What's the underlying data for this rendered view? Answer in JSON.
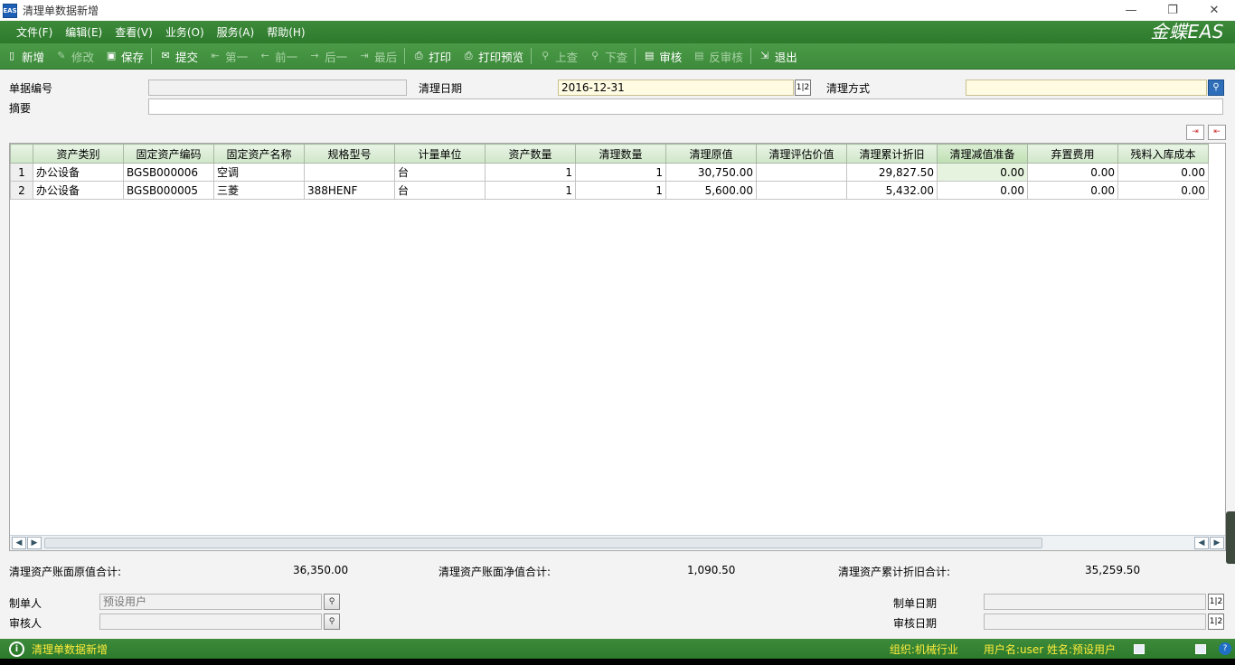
{
  "window": {
    "app_icon": "EAS",
    "title": "清理单数据新增",
    "minimize": "—",
    "restore": "❐",
    "close": "✕"
  },
  "menu": {
    "items": [
      "文件(F)",
      "编辑(E)",
      "查看(V)",
      "业务(O)",
      "服务(A)",
      "帮助(H)"
    ],
    "brand": "金蝶EAS"
  },
  "toolbar": {
    "new": "新增",
    "modify": "修改",
    "save": "保存",
    "submit": "提交",
    "first": "第一",
    "prev": "前一",
    "next": "后一",
    "last": "最后",
    "print": "打印",
    "print_preview": "打印预览",
    "up_query": "上查",
    "down_query": "下查",
    "audit": "审核",
    "unaudit": "反审核",
    "exit": "退出"
  },
  "form": {
    "bill_no_label": "单据编号",
    "bill_no_value": "",
    "clear_date_label": "清理日期",
    "clear_date_value": "2016-12-31",
    "clear_method_label": "清理方式",
    "clear_method_value": "",
    "summary_label": "摘要",
    "summary_value": ""
  },
  "grid": {
    "columns": [
      "",
      "资产类别",
      "固定资产编码",
      "固定资产名称",
      "规格型号",
      "计量单位",
      "资产数量",
      "清理数量",
      "清理原值",
      "清理评估价值",
      "清理累计折旧",
      "清理减值准备",
      "弃置费用",
      "残料入库成本"
    ],
    "rows": [
      [
        "1",
        "办公设备",
        "BGSB000006",
        "空调",
        "",
        "台",
        "1",
        "1",
        "30,750.00",
        "",
        "29,827.50",
        "0.00",
        "0.00",
        "0.00"
      ],
      [
        "2",
        "办公设备",
        "BGSB000005",
        "三菱",
        "388HENF",
        "台",
        "1",
        "1",
        "5,600.00",
        "",
        "5,432.00",
        "0.00",
        "0.00",
        "0.00"
      ]
    ]
  },
  "totals": {
    "original_label": "清理资产账面原值合计:",
    "original_value": "36,350.00",
    "net_label": "清理资产账面净值合计:",
    "net_value": "1,090.50",
    "depr_label": "清理资产累计折旧合计:",
    "depr_value": "35,259.50"
  },
  "footer": {
    "creator_label": "制单人",
    "creator_value": "预设用户",
    "auditor_label": "审核人",
    "auditor_value": "",
    "create_date_label": "制单日期",
    "create_date_value": "",
    "audit_date_label": "审核日期",
    "audit_date_value": ""
  },
  "status": {
    "message": "清理单数据新增",
    "org": "组织:机械行业",
    "user": "用户名:user 姓名:预设用户"
  }
}
